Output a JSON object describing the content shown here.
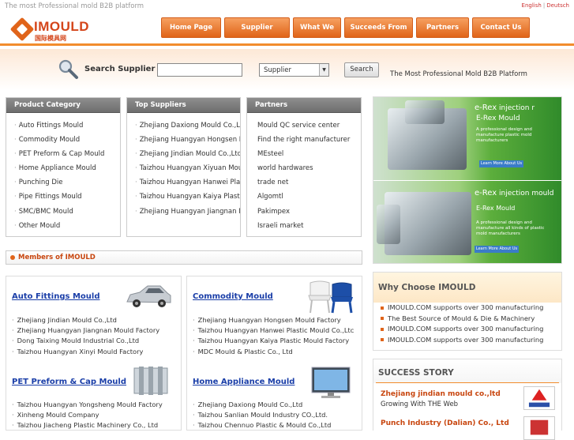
{
  "topbar": {
    "tagline": "The most Professional mold B2B platform",
    "lang_en": "English",
    "lang_sep": "|",
    "lang_de": "Deutsch"
  },
  "logo": {
    "text": "IMOULD",
    "cn": "国际模具网"
  },
  "nav": [
    {
      "label": "Home Page"
    },
    {
      "label": "Supplier Directory"
    },
    {
      "label": "What We do?"
    },
    {
      "label": "Succeeds From Here"
    },
    {
      "label": "Partners"
    },
    {
      "label": "Contact Us"
    }
  ],
  "search": {
    "label": "Search Supplier :",
    "input_value": "",
    "select_value": "Supplier",
    "button": "Search",
    "tagline": "The Most Professional Mold B2B Platform"
  },
  "product_category": {
    "title": "Product Category",
    "items": [
      "Auto Fittings Mould",
      "Commodity Mould",
      "PET Preform & Cap Mould",
      "Home Appliance Mould",
      "Punching Die",
      "Pipe Fittings Mould",
      "SMC/BMC Mould",
      "Other Mould"
    ]
  },
  "top_suppliers": {
    "title": "Top Suppliers",
    "items": [
      "Zhejiang Daxiong Mould Co.,Ltc",
      "Zhejiang Huangyan Hongsen M",
      "Zhejiang Jindian Mould Co.,Ltd",
      "Taizhou Huangyan Xiyuan Moul",
      "Taizhou Huangyan Hanwei Plas",
      "Taizhou Huangyan Kaiya Plastic",
      "Zhejiang Huangyan Jiangnan M"
    ]
  },
  "partners": {
    "title": "Partners",
    "items": [
      "Mould QC service center",
      "Find the right manufacturer",
      "MEsteel",
      "world hardwares",
      "trade net",
      "Algomtl",
      "Pakimpex",
      "Israeli market"
    ]
  },
  "promo": [
    {
      "title_a": "e-Rex",
      "title_b": "injection r",
      "subtitle": "E-Rex Mould",
      "desc": "A professional design and manufacture plastic mold manufacturers",
      "button": "Learn More About Us"
    },
    {
      "title_a": "e-Rex",
      "title_b": "injection mould",
      "subtitle": "E-Rex Mould",
      "desc": "A professional design and manufacture all kinds of plastic mold manufacturers",
      "button": "Learn More About Us"
    }
  ],
  "members": {
    "title": "Members of IMOULD"
  },
  "categories_left": [
    {
      "title": "Auto Fittings Mould",
      "items": [
        "Zhejiang Jindian Mould Co.,Ltd",
        "Zhejiang Huangyan Jiangnan Mould Factory",
        "Dong Taixing Mould Industrial Co.,Ltd",
        "Taizhou Huangyan Xinyi Mould Factory"
      ]
    },
    {
      "title": "PET Preform & Cap Mould",
      "items": [
        "Taizhou Huangyan Yongsheng Mould Factory",
        "Xinheng Mould Company",
        "Taizhou Jiacheng Plastic Machinery Co., Ltd"
      ]
    }
  ],
  "categories_right": [
    {
      "title": "Commodity Mould",
      "items": [
        "Zhejiang Huangyan Hongsen Mould Factory",
        "Taizhou Huangyan Hanwei Plastic Mould Co.,Ltc",
        "Taizhou Huangyan Kaiya Plastic Mould Factory",
        "MDC Mould & Plastic Co., Ltd"
      ]
    },
    {
      "title": "Home Appliance Mould",
      "items": [
        "Zhejiang Daxiong Mould Co.,Ltd",
        "Taizhou Sanlian Mould Industry CO.,Ltd.",
        "Taizhou Chennuo Plastic & Mould Co.,Ltd"
      ]
    }
  ],
  "why": {
    "title": "Why Choose IMOULD",
    "items": [
      "IMOULD.COM supports over 300 manufacturing",
      "The Best Source of Mould & Die & Machinery",
      "IMOULD.COM supports over 300 manufacturing",
      "IMOULD.COM supports over 300 manufacturing"
    ]
  },
  "story": {
    "title": "SUCCESS STORY",
    "entries": [
      {
        "company": "Zhejiang jindian mould co.,ltd",
        "sub": "Growing With THE Web"
      },
      {
        "company": "Punch Industry (Dalian) Co., Ltd",
        "sub": ""
      }
    ]
  },
  "colors": {
    "accent": "#e0641a",
    "link": "#1a3ea8",
    "panel_header": "#7a7a7a"
  }
}
